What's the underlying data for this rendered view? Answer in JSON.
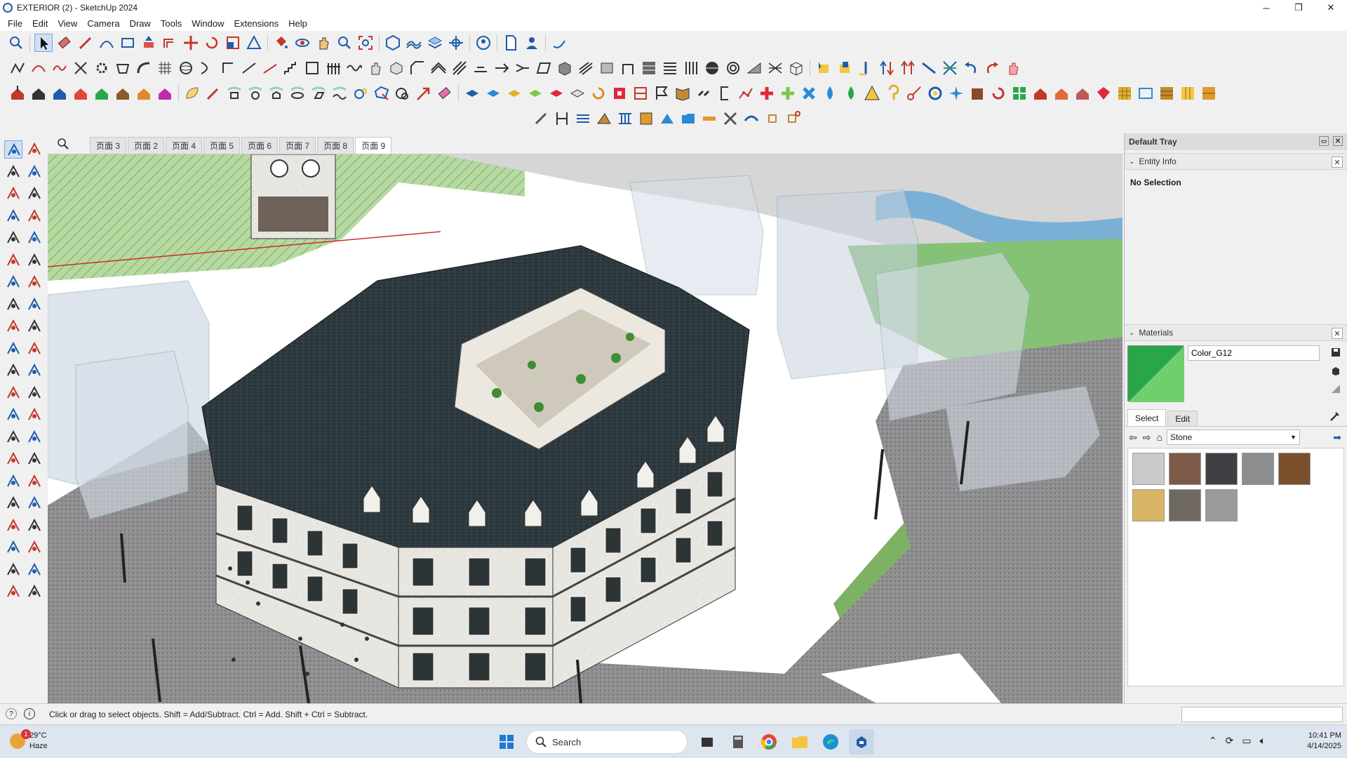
{
  "window": {
    "title": "EXTERIOR  (2) - SketchUp 2024",
    "minimize": "─",
    "maximize": "❐",
    "close": "✕"
  },
  "menu": [
    "File",
    "Edit",
    "View",
    "Camera",
    "Draw",
    "Tools",
    "Window",
    "Extensions",
    "Help"
  ],
  "scene_tabs": {
    "search_icon": "search-icon",
    "tabs": [
      "页面 3",
      "页面 2",
      "页面 4",
      "页面 5",
      "页面 6",
      "页面 7",
      "页面 8",
      "页面 9"
    ],
    "active": "页面 9"
  },
  "tray": {
    "title": "Default Tray",
    "entity_info": {
      "header": "Entity Info",
      "selection": "No Selection"
    },
    "materials": {
      "header": "Materials",
      "material_name": "Color_G12",
      "swatch_color": "#2aa64a",
      "tabs": [
        "Select",
        "Edit"
      ],
      "active_tab": "Select",
      "library": "Stone",
      "swatches": [
        {
          "name": "marble-white",
          "color": "#c9cccb"
        },
        {
          "name": "granite-brown",
          "color": "#7d5a48"
        },
        {
          "name": "slate-dark",
          "color": "#3e4044"
        },
        {
          "name": "concrete-gray",
          "color": "#8c8d8e"
        },
        {
          "name": "wood-brown",
          "color": "#7a4f2c"
        },
        {
          "name": "sandstone",
          "color": "#d8b565"
        },
        {
          "name": "granite-gray-brown",
          "color": "#6f6863"
        },
        {
          "name": "granite-light",
          "color": "#9a9a9c"
        }
      ]
    }
  },
  "status": {
    "message": "Click or drag to select objects. Shift = Add/Subtract. Ctrl = Add. Shift + Ctrl = Subtract."
  },
  "taskbar": {
    "weather_temp": "29°C",
    "weather_desc": "Haze",
    "weather_badge": "1",
    "search_placeholder": "Search",
    "time": "10:41 PM",
    "date": "4/14/2025"
  },
  "colors": {
    "accent": "#1f5da8",
    "sky": "#ffffff",
    "ground": "#8a8a8c",
    "grass": "#7fbf5a",
    "roof": "#2f3b40"
  }
}
